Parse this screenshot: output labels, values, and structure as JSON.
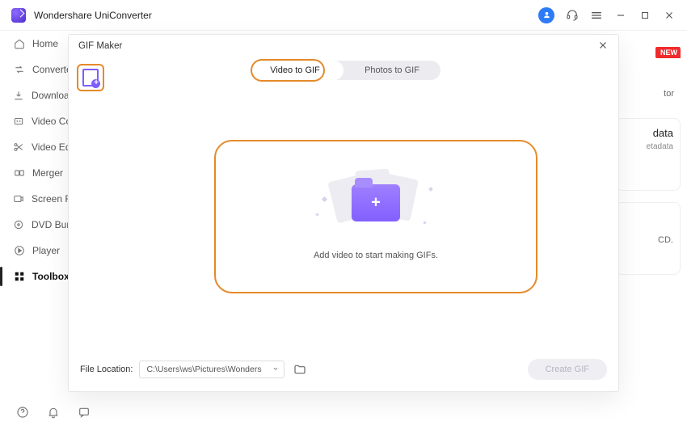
{
  "app": {
    "title": "Wondershare UniConverter"
  },
  "sidebar": {
    "items": [
      {
        "label": "Home"
      },
      {
        "label": "Converter"
      },
      {
        "label": "Downloader"
      },
      {
        "label": "Video Compressor"
      },
      {
        "label": "Video Editor"
      },
      {
        "label": "Merger"
      },
      {
        "label": "Screen Recorder"
      },
      {
        "label": "DVD Burner"
      },
      {
        "label": "Player"
      },
      {
        "label": "Toolbox"
      }
    ]
  },
  "bgcards": {
    "card1": {
      "badge": "NEW",
      "line": "tor"
    },
    "card2": {
      "title": "data",
      "sub": "etadata"
    },
    "card3": {
      "sub": "CD."
    }
  },
  "modal": {
    "title": "GIF Maker",
    "tabs": {
      "video": "Video to GIF",
      "photos": "Photos to GIF"
    },
    "dropMessage": "Add video to start making GIFs.",
    "fileLocationLabel": "File Location:",
    "fileLocationValue": "C:\\Users\\ws\\Pictures\\Wonders",
    "createLabel": "Create GIF"
  }
}
